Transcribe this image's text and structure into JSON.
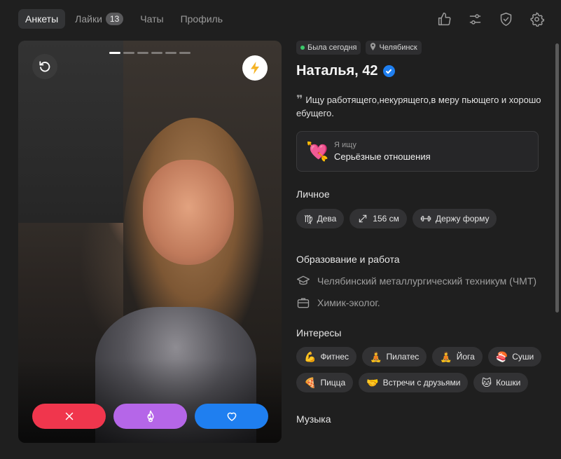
{
  "nav": {
    "tabs": [
      {
        "label": "Анкеты",
        "active": true
      },
      {
        "label": "Лайки",
        "badge": "13"
      },
      {
        "label": "Чаты"
      },
      {
        "label": "Профиль"
      }
    ],
    "icons": [
      "thumbs-up-icon",
      "sliders-icon",
      "shield-check-icon",
      "gear-icon"
    ]
  },
  "card": {
    "photo_count": 6,
    "current_photo": 1,
    "undo_icon": "undo-icon",
    "boost_icon": "lightning-icon",
    "actions": [
      {
        "name": "dislike",
        "icon": "x-icon",
        "color": "#f0364d"
      },
      {
        "name": "superlike",
        "icon": "flame-icon",
        "color": "#b566e8"
      },
      {
        "name": "like",
        "icon": "heart-icon",
        "color": "#1f7ff0"
      }
    ]
  },
  "profile": {
    "last_seen": "Была сегодня",
    "city": "Челябинск",
    "name": "Наталья, 42",
    "bio": "Ищу работящего,некурящего,в меру пьющего и хорошо ебущего.",
    "seeking": {
      "emoji": "💘",
      "label": "Я ищу",
      "value": "Серьёзные отношения"
    },
    "personal_title": "Личное",
    "personal": [
      {
        "icon": "zodiac-virgo-icon",
        "text": "Дева"
      },
      {
        "icon": "height-icon",
        "text": "156 см"
      },
      {
        "icon": "dumbbell-icon",
        "text": "Держу форму"
      }
    ],
    "work_title": "Образование и работа",
    "education": "Челябинский металлургический техникум (ЧМТ)",
    "job": "Химик-эколог.",
    "interests_title": "Интересы",
    "interests": [
      {
        "emoji": "💪",
        "text": "Фитнес"
      },
      {
        "emoji": "🧘",
        "text": "Пилатес"
      },
      {
        "emoji": "🧘",
        "text": "Йога"
      },
      {
        "emoji": "🍣",
        "text": "Суши"
      },
      {
        "emoji": "🍕",
        "text": "Пицца"
      },
      {
        "emoji": "🤝",
        "text": "Встречи с друзьями"
      },
      {
        "emoji": "🐱",
        "text": "Кошки"
      }
    ],
    "music_title": "Музыка"
  },
  "colors": {
    "accent": "#1f7ff0",
    "online": "#3cc96a",
    "background": "#1f1f1f"
  }
}
